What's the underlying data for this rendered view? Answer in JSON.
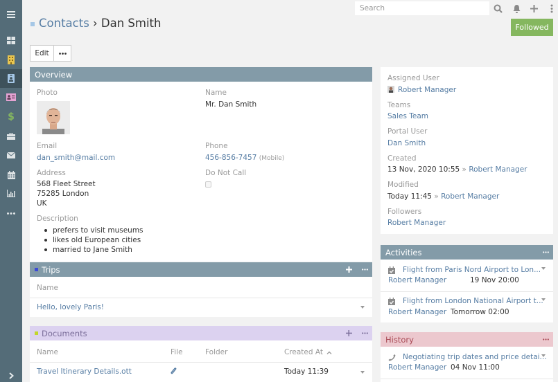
{
  "topbar": {
    "search_placeholder": "Search"
  },
  "sidebar": {
    "items": [
      {
        "name": "menu-toggle",
        "icon": "hamburger-icon"
      },
      {
        "name": "home",
        "icon": "dashboard-grid-icon"
      },
      {
        "name": "accounts",
        "icon": "building-icon",
        "color": "#e9c550"
      },
      {
        "name": "contacts",
        "icon": "contact-badge-icon",
        "color": "#a5c7e6",
        "active": true
      },
      {
        "name": "leads",
        "icon": "id-card-icon",
        "color": "#e5a3d3"
      },
      {
        "name": "opportunities",
        "icon": "dollar-icon",
        "color": "#85b75f"
      },
      {
        "name": "cases",
        "icon": "briefcase-icon"
      },
      {
        "name": "emails",
        "icon": "envelope-icon"
      },
      {
        "name": "calendar",
        "icon": "calendar-icon"
      },
      {
        "name": "reports",
        "icon": "bar-chart-icon"
      },
      {
        "name": "more",
        "icon": "ellipsis-icon"
      },
      {
        "name": "collapse",
        "icon": "chevron-right-icon"
      }
    ]
  },
  "header": {
    "breadcrumb_parent": "Contacts",
    "separator": "›",
    "title": "Dan Smith",
    "accent_color": "#a5c7e6",
    "followed_label": "Followed",
    "edit_label": "Edit",
    "more_label": "•••"
  },
  "overview": {
    "title": "Overview",
    "photo_label": "Photo",
    "name_label": "Name",
    "name_value": "Mr. Dan Smith",
    "email_label": "Email",
    "email_value": "dan_smith@mail.com",
    "phone_label": "Phone",
    "phone_value": "456-856-7457",
    "phone_type": "(Mobile)",
    "address_label": "Address",
    "address_lines": [
      "568 Fleet Street",
      "75285 London",
      "UK"
    ],
    "do_not_call_label": "Do Not Call",
    "do_not_call_checked": false,
    "description_label": "Description",
    "description_items": [
      "prefers to visit museums",
      "likes old European cities",
      "married to Jane Smith"
    ]
  },
  "trips": {
    "title": "Trips",
    "accent_color": "#3c4bd6",
    "columns": [
      "Name"
    ],
    "rows": [
      {
        "name": "Hello, lovely Paris!"
      }
    ]
  },
  "documents": {
    "title": "Documents",
    "accent_color": "#c2d62c",
    "columns": [
      "Name",
      "File",
      "Folder",
      "Created At"
    ],
    "sort_indicator": "^",
    "rows": [
      {
        "name": "Travel Itinerary Details.ott",
        "file": "paperclip-icon",
        "folder": "",
        "created_at": "Today 11:39"
      }
    ]
  },
  "side": {
    "assigned_user_label": "Assigned User",
    "assigned_user": "Robert Manager",
    "teams_label": "Teams",
    "teams": "Sales Team",
    "portal_user_label": "Portal User",
    "portal_user": "Dan Smith",
    "created_label": "Created",
    "created_at": "13 Nov, 2020 10:55",
    "created_by": "Robert Manager",
    "modified_label": "Modified",
    "modified_at": "Today 11:45",
    "modified_by": "Robert Manager",
    "followers_label": "Followers",
    "followers": "Robert Manager",
    "arrow": "»"
  },
  "activities": {
    "title": "Activities",
    "items": [
      {
        "title": "Flight from Paris Nord Airport to Lon...",
        "user": "Robert Manager",
        "date": "19 Nov 20:00",
        "icon": "calendar-check-icon"
      },
      {
        "title": "Flight from London National Airport t...",
        "user": "Robert Manager",
        "date": "Tomorrow 02:00",
        "icon": "calendar-check-icon"
      }
    ]
  },
  "history": {
    "title": "History",
    "items": [
      {
        "title": "Negotiating trip dates and price detai...",
        "user": "Robert Manager",
        "date": "04 Nov 11:00",
        "icon": "phone-icon"
      }
    ]
  }
}
